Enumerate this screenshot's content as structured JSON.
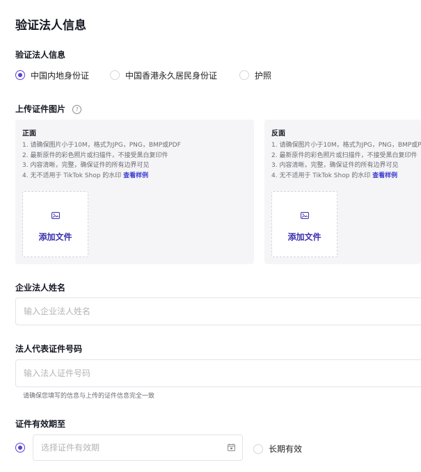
{
  "page_title": "验证法人信息",
  "id_section": {
    "label": "验证法人信息",
    "options": [
      {
        "label": "中国内地身份证",
        "selected": true
      },
      {
        "label": "中国香港永久居民身份证",
        "selected": false
      },
      {
        "label": "护照",
        "selected": false
      }
    ]
  },
  "upload_section": {
    "label": "上传证件图片",
    "help_glyph": "?",
    "front": {
      "title": "正面",
      "line1": "1. 请确保图片小于10M，格式为JPG，PNG，BMP或PDF",
      "line2": "2. 最新原件的彩色照片或扫描件，不接受黑白复印件",
      "line3": "3. 内容清晰，完整，确保证件的所有边界可见",
      "line4": "4. 无不适用于 TikTok Shop 的水印",
      "sample_link": "查看样例",
      "add_label": "添加文件"
    },
    "back": {
      "title": "反面",
      "line1": "1. 请确保图片小于10M，格式为JPG，PNG，BMP或PDF",
      "line2": "2. 最新原件的彩色照片或扫描件，不接受黑白复印件",
      "line3": "3. 内容清晰，完整，确保证件的所有边界可见",
      "line4": "4. 无不适用于 TikTok Shop 的水印",
      "sample_link": "查看样例",
      "add_label": "添加文件"
    }
  },
  "name_field": {
    "label": "企业法人姓名",
    "placeholder": "输入企业法人姓名"
  },
  "id_number_field": {
    "label": "法人代表证件号码",
    "placeholder": "输入法人证件号码",
    "hint": "请确保您填写的信息与上传的证件信息完全一致"
  },
  "expiry_section": {
    "label": "证件有效期至",
    "date_placeholder": "选择证件有效期",
    "long_term_label": "长期有效"
  },
  "colors": {
    "accent": "#5b3fd6",
    "link": "#3d3ecf",
    "card_bg": "#f5f5f7"
  },
  "icons": {
    "help": "help-circle-icon",
    "upload": "image-icon",
    "date": "calendar-icon"
  }
}
